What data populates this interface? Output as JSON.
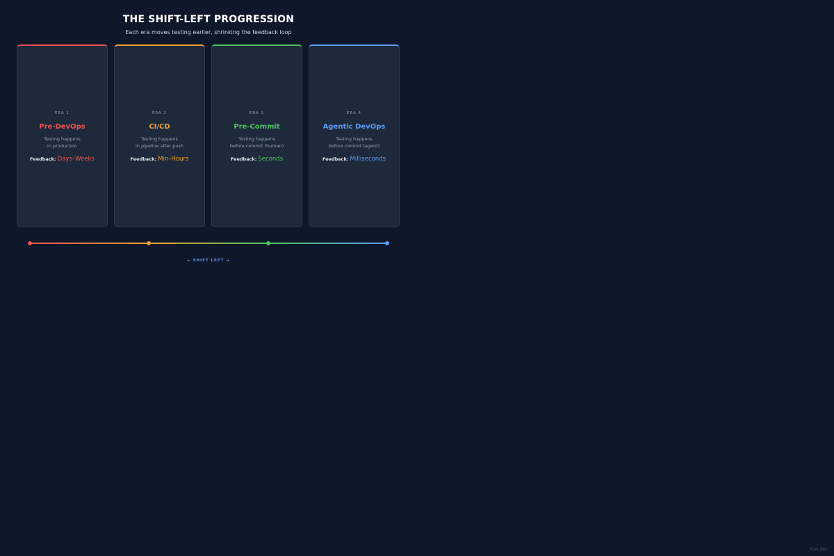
{
  "header": {
    "title": "THE SHIFT-LEFT PROGRESSION",
    "subtitle": "Each era moves testing earlier, shrinking the feedback loop"
  },
  "eras": [
    {
      "era_label": "ERA 1",
      "name": "Pre-DevOps",
      "desc_line1": "Testing happens",
      "desc_line2": "in production",
      "feedback_label": "Feedback:",
      "feedback_value": "Days–Weeks",
      "color": "#ef5350"
    },
    {
      "era_label": "ERA 2",
      "name": "CI/CD",
      "desc_line1": "Testing happens",
      "desc_line2": "in pipeline after push",
      "feedback_label": "Feedback:",
      "feedback_value": "Min–Hours",
      "color": "#f0a030"
    },
    {
      "era_label": "ERA 3",
      "name": "Pre-Commit",
      "desc_line1": "Testing happens",
      "desc_line2": "before commit (human)",
      "feedback_label": "Feedback:",
      "feedback_value": "Seconds",
      "color": "#4ac45a"
    },
    {
      "era_label": "ERA 4",
      "name": "Agentic DevOps",
      "desc_line1": "Testing happens",
      "desc_line2": "before commit (agent)",
      "feedback_label": "Feedback:",
      "feedback_value": "Milliseconds",
      "color": "#5b9cf5"
    }
  ],
  "timeline": {
    "label": "← SHIFT LEFT →"
  },
  "footer": {
    "watermark": "htek.dev"
  }
}
